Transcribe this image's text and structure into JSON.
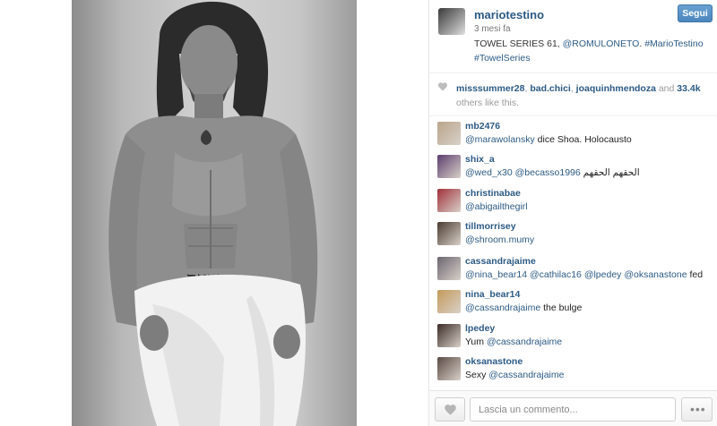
{
  "post": {
    "username": "mariotestino",
    "time": "3 mesi fa",
    "caption_text": "TOWEL SERIES 61, ",
    "caption_mention": "@ROMULONETO",
    "caption_sep": ". ",
    "caption_tag1": "#MarioTestino",
    "caption_tag2": "#TowelSeries",
    "follow_label": "Segui"
  },
  "likes": {
    "user1": "misssummer28",
    "user2": "bad.chici",
    "user3": "joaquinhmendoza",
    "and_text": "and",
    "count": "33.4k",
    "suffix": "others like this."
  },
  "comments": [
    {
      "user": "mb2476",
      "mention": "@marawolansky",
      "text": " dice Shoa. Holocausto",
      "avatar_color": "#b9a58a"
    },
    {
      "user": "shix_a",
      "mention": "@wed_x30 @becasso1996",
      "text": " الحقهم الحقهم",
      "avatar_color": "#5b3d6e"
    },
    {
      "user": "christinabae",
      "mention": "@abigailthegirl",
      "text": "",
      "avatar_color": "#a0303a"
    },
    {
      "user": "tillmorrisey",
      "mention": "@shroom.mumy",
      "text": "",
      "avatar_color": "#4a3b30"
    },
    {
      "user": "cassandrajaime",
      "mention": "@nina_bear14 @cathilac16 @lpedey @oksanastone",
      "text": " fed",
      "avatar_color": "#6b6570"
    },
    {
      "user": "nina_bear14",
      "mention": "@cassandrajaime",
      "text": " the bulge",
      "avatar_color": "#c49a5a"
    },
    {
      "user": "lpedey",
      "prefix": "Yum ",
      "mention": "@cassandrajaime",
      "text": "",
      "avatar_color": "#3a2a26"
    },
    {
      "user": "oksanastone",
      "prefix": "Sexy ",
      "mention": "@cassandrajaime",
      "text": "",
      "avatar_color": "#5a4a44"
    }
  ],
  "footer": {
    "comment_placeholder": "Lascia un commento...",
    "more_label": "•••"
  },
  "colors": {
    "link": "#2c5a85",
    "follow_button": "#4a86bd"
  },
  "icons": [
    "heart-icon",
    "heart-outline-icon",
    "more-dots-icon"
  ]
}
